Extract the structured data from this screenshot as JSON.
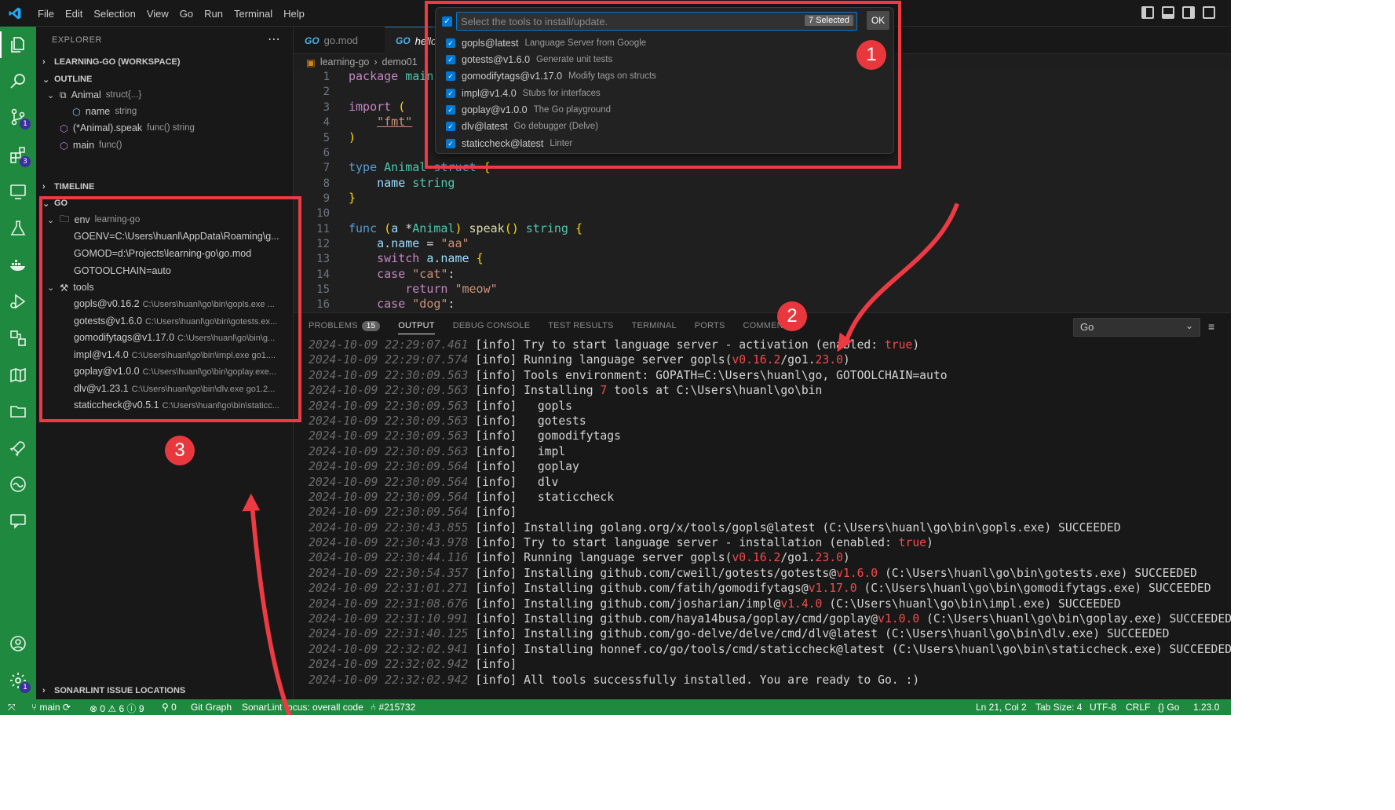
{
  "menu": [
    "File",
    "Edit",
    "Selection",
    "View",
    "Go",
    "Run",
    "Terminal",
    "Help"
  ],
  "activity_bar": {
    "scm_badge": "1",
    "extensions_badge": "3",
    "manage_badge": "1"
  },
  "sidebar": {
    "title": "EXPLORER",
    "workspace": "LEARNING-GO (WORKSPACE)",
    "outline": {
      "title": "OUTLINE",
      "items": [
        {
          "name": "Animal",
          "desc": "struct{...}"
        },
        {
          "name": "name",
          "desc": "string"
        },
        {
          "name": "(*Animal).speak",
          "desc": "func() string"
        },
        {
          "name": "main",
          "desc": "func()"
        }
      ]
    },
    "timeline": "TIMELINE",
    "go": {
      "title": "GO",
      "env_label": "env",
      "env_desc": "learning-go",
      "env_items": [
        "GOENV=C:\\Users\\huanl\\AppData\\Roaming\\g...",
        "GOMOD=d:\\Projects\\learning-go\\go.mod",
        "GOTOOLCHAIN=auto"
      ],
      "tools_label": "tools",
      "tools": [
        {
          "name": "gopls@v0.16.2",
          "path": "C:\\Users\\huanl\\go\\bin\\gopls.exe ..."
        },
        {
          "name": "gotests@v1.6.0",
          "path": "C:\\Users\\huanl\\go\\bin\\gotests.ex..."
        },
        {
          "name": "gomodifytags@v1.17.0",
          "path": "C:\\Users\\huanl\\go\\bin\\g..."
        },
        {
          "name": "impl@v1.4.0",
          "path": "C:\\Users\\huanl\\go\\bin\\impl.exe go1...."
        },
        {
          "name": "goplay@v1.0.0",
          "path": "C:\\Users\\huanl\\go\\bin\\goplay.exe..."
        },
        {
          "name": "dlv@v1.23.1",
          "path": "C:\\Users\\huanl\\go\\bin\\dlv.exe go1.2..."
        },
        {
          "name": "staticcheck@v0.5.1",
          "path": "C:\\Users\\huanl\\go\\bin\\staticc..."
        }
      ]
    },
    "sonarlint": "SONARLINT ISSUE LOCATIONS"
  },
  "editor": {
    "tabs": [
      "go.mod",
      "hello.go"
    ],
    "breadcrumb": [
      "learning-go",
      "demo01"
    ],
    "line_numbers": [
      "1",
      "2",
      "3",
      "4",
      "5",
      "6",
      "7",
      "8",
      "9",
      "10",
      "11",
      "12",
      "13",
      "14",
      "15",
      "16"
    ]
  },
  "panel": {
    "tabs": [
      "PROBLEMS",
      "OUTPUT",
      "DEBUG CONSOLE",
      "TEST RESULTS",
      "TERMINAL",
      "PORTS",
      "COMMENTS"
    ],
    "problems_count": "15",
    "channel": "Go",
    "log": [
      {
        "ts": "2024-10-09 22:29:07.461",
        "text": " [info] Try to start language server - activation (enabled: ",
        "red": "true",
        "tail": ")"
      },
      {
        "ts": "2024-10-09 22:29:07.574",
        "text": " [info] Running language server gopls(",
        "red": "v0.16.2",
        "tail": "/go1.",
        "red2": "23.0",
        "tail2": ")"
      },
      {
        "ts": "2024-10-09 22:30:09.563",
        "text": " [info] Tools environment: GOPATH=C:\\Users\\huanl\\go, GOTOOLCHAIN=auto"
      },
      {
        "ts": "2024-10-09 22:30:09.563",
        "text": " [info] Installing ",
        "red": "7",
        "tail": " tools at C:\\Users\\huanl\\go\\bin"
      },
      {
        "ts": "2024-10-09 22:30:09.563",
        "text": " [info]   gopls"
      },
      {
        "ts": "2024-10-09 22:30:09.563",
        "text": " [info]   gotests"
      },
      {
        "ts": "2024-10-09 22:30:09.563",
        "text": " [info]   gomodifytags"
      },
      {
        "ts": "2024-10-09 22:30:09.563",
        "text": " [info]   impl"
      },
      {
        "ts": "2024-10-09 22:30:09.564",
        "text": " [info]   goplay"
      },
      {
        "ts": "2024-10-09 22:30:09.564",
        "text": " [info]   dlv"
      },
      {
        "ts": "2024-10-09 22:30:09.564",
        "text": " [info]   staticcheck"
      },
      {
        "ts": "2024-10-09 22:30:09.564",
        "text": " [info]"
      },
      {
        "ts": "2024-10-09 22:30:43.855",
        "text": " [info] Installing golang.org/x/tools/gopls@latest (C:\\Users\\huanl\\go\\bin\\gopls.exe) SUCCEEDED"
      },
      {
        "ts": "2024-10-09 22:30:43.978",
        "text": " [info] Try to start language server - installation (enabled: ",
        "red": "true",
        "tail": ")"
      },
      {
        "ts": "2024-10-09 22:30:44.116",
        "text": " [info] Running language server gopls(",
        "red": "v0.16.2",
        "tail": "/go1.",
        "red2": "23.0",
        "tail2": ")"
      },
      {
        "ts": "2024-10-09 22:30:54.357",
        "text": " [info] Installing github.com/cweill/gotests/gotests@",
        "red": "v1.6.0",
        "tail": " (C:\\Users\\huanl\\go\\bin\\gotests.exe) SUCCEEDED"
      },
      {
        "ts": "2024-10-09 22:31:01.271",
        "text": " [info] Installing github.com/fatih/gomodifytags@",
        "red": "v1.17.0",
        "tail": " (C:\\Users\\huanl\\go\\bin\\gomodifytags.exe) SUCCEEDED"
      },
      {
        "ts": "2024-10-09 22:31:08.676",
        "text": " [info] Installing github.com/josharian/impl@",
        "red": "v1.4.0",
        "tail": " (C:\\Users\\huanl\\go\\bin\\impl.exe) SUCCEEDED"
      },
      {
        "ts": "2024-10-09 22:31:10.991",
        "text": " [info] Installing github.com/haya14busa/goplay/cmd/goplay@",
        "red": "v1.0.0",
        "tail": " (C:\\Users\\huanl\\go\\bin\\goplay.exe) SUCCEEDED"
      },
      {
        "ts": "2024-10-09 22:31:40.125",
        "text": " [info] Installing github.com/go-delve/delve/cmd/dlv@latest (C:\\Users\\huanl\\go\\bin\\dlv.exe) SUCCEEDED"
      },
      {
        "ts": "2024-10-09 22:32:02.941",
        "text": " [info] Installing honnef.co/go/tools/cmd/staticcheck@latest (C:\\Users\\huanl\\go\\bin\\staticcheck.exe) SUCCEEDED"
      },
      {
        "ts": "2024-10-09 22:32:02.942",
        "text": " [info]"
      },
      {
        "ts": "2024-10-09 22:32:02.942",
        "text": " [info] All tools successfully installed. You are ready to Go. :)"
      }
    ]
  },
  "quick_pick": {
    "placeholder": "Select the tools to install/update.",
    "selected_count": "7 Selected",
    "ok_label": "OK",
    "items": [
      {
        "name": "gopls@latest",
        "desc": "Language Server from Google"
      },
      {
        "name": "gotests@v1.6.0",
        "desc": "Generate unit tests"
      },
      {
        "name": "gomodifytags@v1.17.0",
        "desc": "Modify tags on structs"
      },
      {
        "name": "impl@v1.4.0",
        "desc": "Stubs for interfaces"
      },
      {
        "name": "goplay@v1.0.0",
        "desc": "The Go playground"
      },
      {
        "name": "dlv@latest",
        "desc": "Go debugger (Delve)"
      },
      {
        "name": "staticcheck@latest",
        "desc": "Linter"
      }
    ]
  },
  "status_bar": {
    "branch": "main",
    "problems": "0",
    "warnings": "6",
    "infos": "9",
    "ports": "0",
    "git_graph": "Git Graph",
    "sonarlint": "SonarLint focus: overall code",
    "pr": "#215732",
    "position": "Ln 21, Col 2",
    "tab_size": "Tab Size: 4",
    "encoding": "UTF-8",
    "eol": "CRLF",
    "language": "Go",
    "go_version": "1.23.0"
  },
  "annotations": {
    "callout_1": "1",
    "callout_2": "2",
    "callout_3": "3"
  },
  "colors": {
    "activity_bar": "#1f8a3f",
    "accent": "#0078d4",
    "annotation_red": "#ee3a42"
  }
}
